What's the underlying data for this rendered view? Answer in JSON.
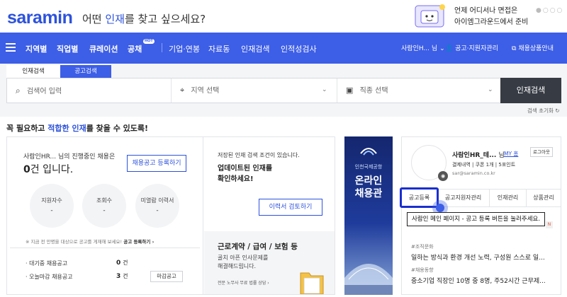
{
  "header": {
    "logo": "saramin",
    "slogan_pre": "어떤 ",
    "slogan_hl": "인재",
    "slogan_post": "를 찾고 싶으세요?",
    "promo_line1": "언제 어디서나 면접은",
    "promo_line2": "아이엠그라운드에서 준비"
  },
  "nav": {
    "items": [
      "지역별",
      "직업별",
      "큐레이션",
      "공채",
      "기업·연봉",
      "자료동",
      "인재검색",
      "인적성검사"
    ],
    "hot_badge": "HOT",
    "user": "사람인H...",
    "user_suffix": "님",
    "apply_manage": "공고·지원자관리",
    "product_manage": "채용상품안내"
  },
  "search": {
    "tabs": [
      "인재검색",
      "공고검색"
    ],
    "keyword_placeholder": "검색어 입력",
    "region_placeholder": "지역 선택",
    "job_placeholder": "직종 선택",
    "button": "인재검색",
    "reset": "검색 초기화"
  },
  "headline": {
    "pre": "꼭 필요하고 ",
    "hl": "적합한 인재",
    "post": "를 찾을 수 있도록!"
  },
  "status_card": {
    "greeting": "사람인HR...  님의 진행중인 채용은",
    "count": "0",
    "count_suffix": "건 입니다.",
    "register_button": "채용공고 등록하기",
    "stats": [
      {
        "label": "지원자수",
        "value": "-"
      },
      {
        "label": "조회수",
        "value": "-"
      },
      {
        "label": "미열람 이력서",
        "value": "-"
      }
    ],
    "notice": "※ 지금 전 만명을 대상으로 공고를 게재해 보세요!",
    "notice_link": "공고 등록하기 ›",
    "rows": [
      {
        "label": "· 대기중 채용공고",
        "value": "0",
        "unit": "건"
      },
      {
        "label": "· 오늘마감 채용공고",
        "value": "3",
        "unit": "건",
        "button": "마감공고"
      }
    ]
  },
  "saved_card": {
    "line1": "저장된 인재 검색 조건이 있습니다.",
    "bold1": "업데이트된 인재를",
    "bold2": "확인하세요!",
    "button": "이력서 검토하기",
    "labor_title": "근로계약 / 급여 / 보험 등",
    "labor_desc1": "골치 아픈 인사문제를",
    "labor_desc2": "해결해드립니다.",
    "labor_link": "전문 노무사 무료 법률 상담 ›"
  },
  "banner": {
    "org": "인천국제공항",
    "line1": "온라인",
    "line2": "채용관"
  },
  "profile": {
    "name": "사람인HR_테...",
    "suffix": "님",
    "my_link": "MY 홈",
    "logout": "로그아웃",
    "info": "결제내역  |  쿠폰 1개  |  5포인트",
    "email": "sar@saramin.co.kr",
    "tabs": [
      "공고등록",
      "공고지원자관리",
      "인재관리",
      "상품관리"
    ],
    "tag1": "#조직문화",
    "news1": "일하는 방식과 환경 개선 노력, 구성원 스스로 일...",
    "tag2": "#채용동향",
    "news2": "중소기업 직장인 10명 중 8명, 주52시간 근무제..."
  },
  "tooltip": "사람인 메인 페이지 - 공고 등록 버튼을 눌러주세요."
}
